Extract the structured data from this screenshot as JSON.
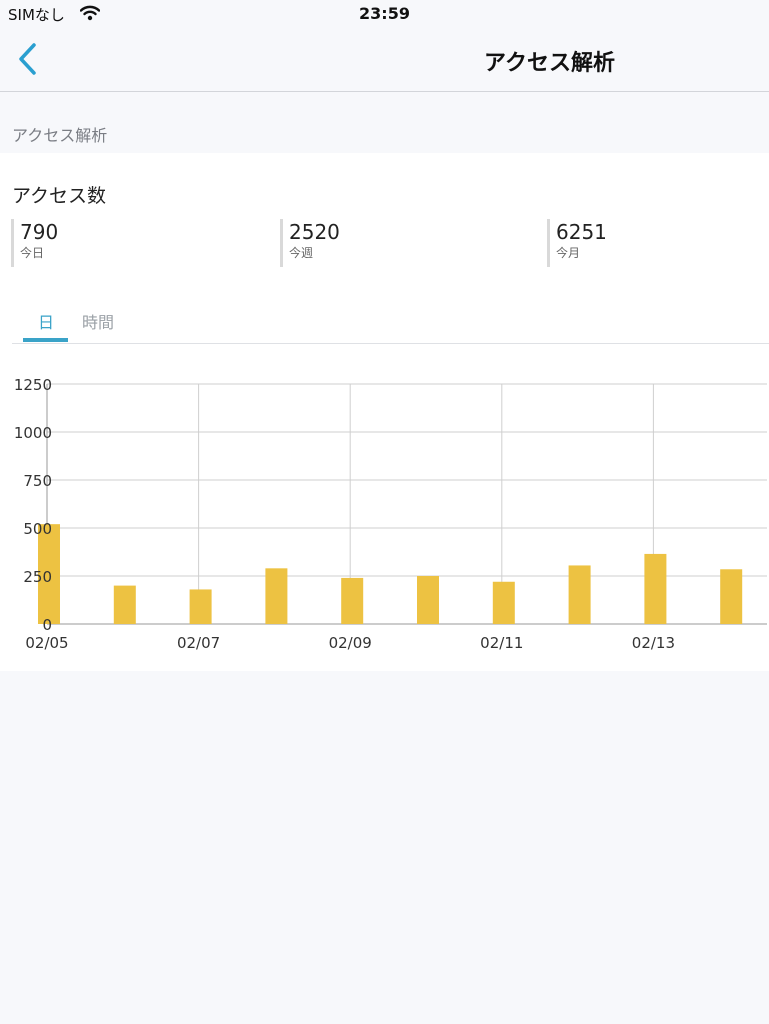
{
  "status_bar": {
    "carrier": "SIMなし",
    "time": "23:59"
  },
  "nav": {
    "title": "アクセス解析"
  },
  "section_header": "アクセス解析",
  "card": {
    "title": "アクセス数",
    "stats": [
      {
        "value": "790",
        "label": "今日"
      },
      {
        "value": "2520",
        "label": "今週"
      },
      {
        "value": "6251",
        "label": "今月"
      }
    ]
  },
  "tabs": [
    {
      "label": "日",
      "active": true
    },
    {
      "label": "時間",
      "active": false
    }
  ],
  "colors": {
    "accent": "#3aa3c8",
    "bar": "#edc242",
    "grid": "#cfcfcf"
  },
  "chart_data": {
    "type": "bar",
    "categories": [
      "02/05",
      "02/06",
      "02/07",
      "02/08",
      "02/09",
      "02/10",
      "02/11",
      "02/12",
      "02/13",
      "02/14"
    ],
    "values": [
      520,
      200,
      180,
      290,
      240,
      250,
      220,
      305,
      365,
      285
    ],
    "x_tick_labels": [
      "02/05",
      "02/07",
      "02/09",
      "02/11",
      "02/13"
    ],
    "y_ticks": [
      0,
      250,
      500,
      750,
      1000,
      1250
    ],
    "ylim": [
      0,
      1250
    ],
    "grid": true
  }
}
